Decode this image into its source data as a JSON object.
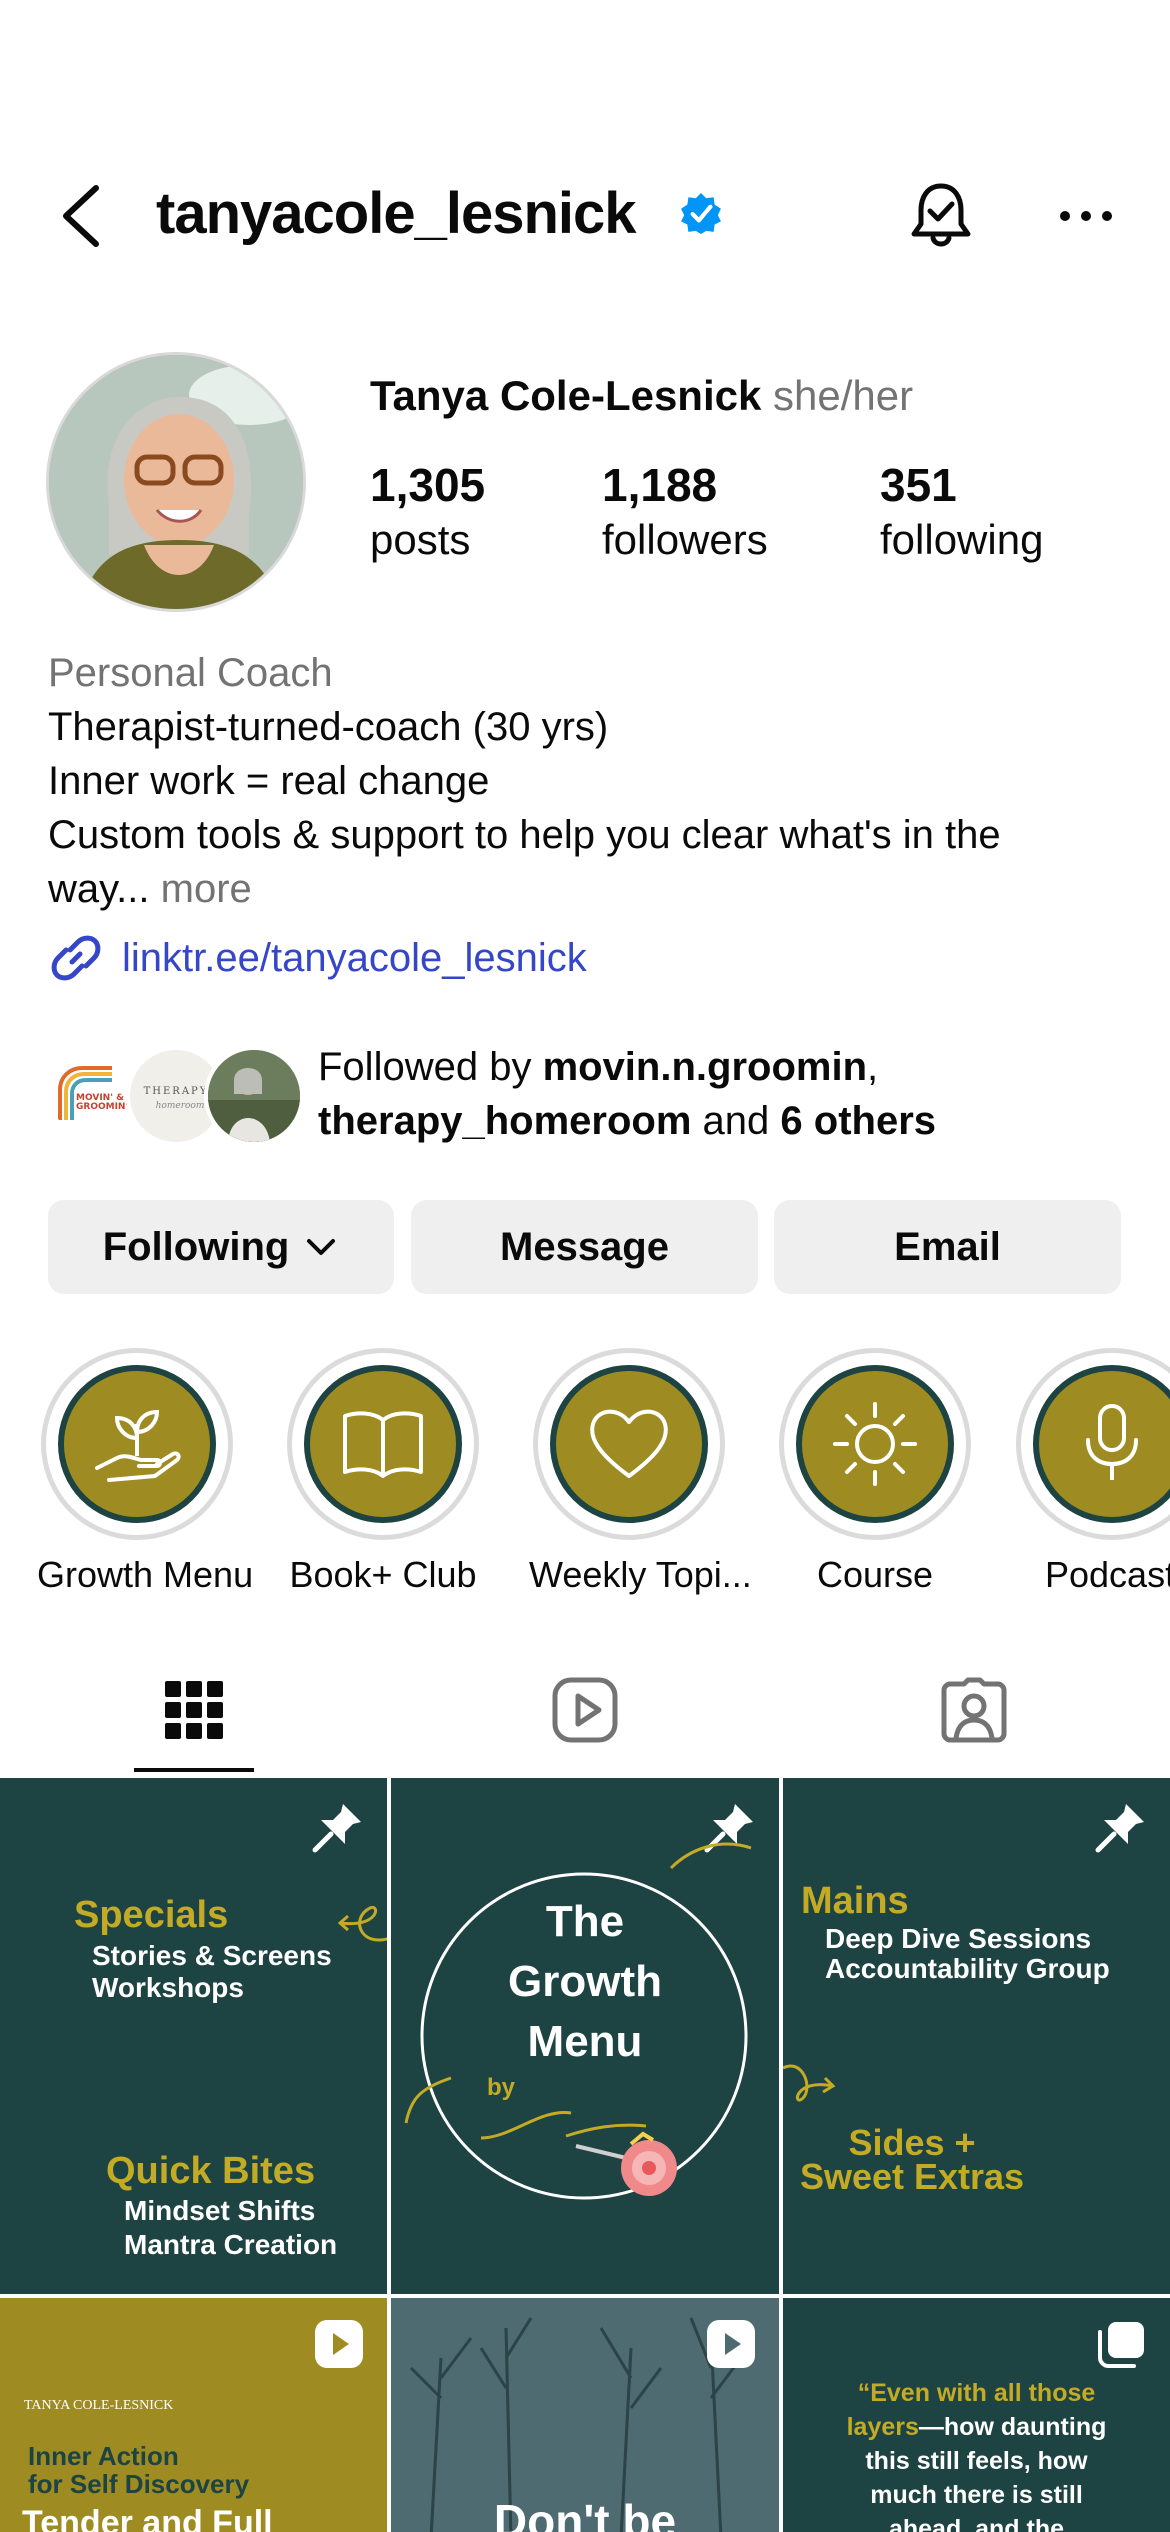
{
  "header": {
    "username": "tanyacole_lesnick"
  },
  "profile": {
    "full_name": "Tanya Cole-Lesnick",
    "pronouns": "she/her",
    "stats": [
      {
        "value": "1,305",
        "label": "posts"
      },
      {
        "value": "1,188",
        "label": "followers"
      },
      {
        "value": "351",
        "label": "following"
      }
    ],
    "category": "Personal Coach",
    "bio_lines": [
      "Therapist-turned-coach (30 yrs)",
      "Inner work = real change",
      "Custom tools & support to help you clear what's in the",
      "way..."
    ],
    "bio_more": "more",
    "link": "linktr.ee/tanyacole_lesnick"
  },
  "followed_by": {
    "prefix": "Followed by",
    "user1": "movin.n.groomin",
    "comma": ",",
    "user2": "therapy_homeroom",
    "and": "and",
    "others": "6 others",
    "avatar1_text": "MOVIN' & GROOMIN'",
    "avatar2_text": "THERAPY homeroom"
  },
  "actions": {
    "following": "Following",
    "message": "Message",
    "email": "Email"
  },
  "highlights": [
    {
      "label": "Growth Menu",
      "icon": "plant-hand-icon"
    },
    {
      "label": "Book+ Club",
      "icon": "open-book-icon"
    },
    {
      "label": "Weekly Topi...",
      "icon": "heart-icon"
    },
    {
      "label": "Course",
      "icon": "sun-icon"
    },
    {
      "label": "Podcast",
      "icon": "microphone-icon"
    }
  ],
  "posts": {
    "p1": {
      "heading1": "Specials",
      "lines1": [
        "Stories & Screens",
        "Workshops"
      ],
      "heading2": "Quick Bites",
      "lines2": [
        "Mindset Shifts",
        "Mantra Creation"
      ]
    },
    "p2": {
      "title_lines": [
        "The",
        "Growth",
        "Menu"
      ],
      "by": "by"
    },
    "p3": {
      "heading1": "Mains",
      "lines1": [
        "Deep Dive Sessions",
        "Accountability Group"
      ],
      "heading2_lines": [
        "Sides +",
        "Sweet Extras"
      ]
    },
    "p4": {
      "brand": "TANYA COLE-LESNICK",
      "lines": [
        "Inner Action",
        "for Self Discovery"
      ],
      "big": "Tender and Full"
    },
    "p5": {
      "big": "Don't be"
    },
    "p6": {
      "quote_lines": [
        "“Even with all those",
        "layers",
        "—how daunting",
        "this still feels, how",
        "much there is still",
        "ahead, and the"
      ]
    }
  },
  "colors": {
    "teal": "#1d4342",
    "gold": "#c4ab25",
    "link_blue": "#3546c9",
    "verified_blue": "#0095f6"
  }
}
